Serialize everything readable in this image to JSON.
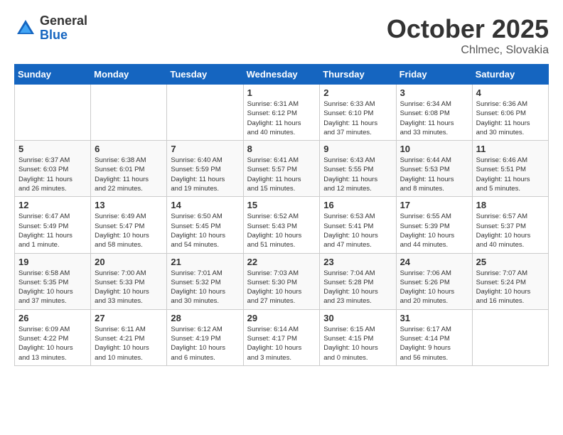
{
  "header": {
    "logo_general": "General",
    "logo_blue": "Blue",
    "month_title": "October 2025",
    "location": "Chlmec, Slovakia"
  },
  "days_of_week": [
    "Sunday",
    "Monday",
    "Tuesday",
    "Wednesday",
    "Thursday",
    "Friday",
    "Saturday"
  ],
  "weeks": [
    [
      {
        "day": "",
        "info": ""
      },
      {
        "day": "",
        "info": ""
      },
      {
        "day": "",
        "info": ""
      },
      {
        "day": "1",
        "info": "Sunrise: 6:31 AM\nSunset: 6:12 PM\nDaylight: 11 hours\nand 40 minutes."
      },
      {
        "day": "2",
        "info": "Sunrise: 6:33 AM\nSunset: 6:10 PM\nDaylight: 11 hours\nand 37 minutes."
      },
      {
        "day": "3",
        "info": "Sunrise: 6:34 AM\nSunset: 6:08 PM\nDaylight: 11 hours\nand 33 minutes."
      },
      {
        "day": "4",
        "info": "Sunrise: 6:36 AM\nSunset: 6:06 PM\nDaylight: 11 hours\nand 30 minutes."
      }
    ],
    [
      {
        "day": "5",
        "info": "Sunrise: 6:37 AM\nSunset: 6:03 PM\nDaylight: 11 hours\nand 26 minutes."
      },
      {
        "day": "6",
        "info": "Sunrise: 6:38 AM\nSunset: 6:01 PM\nDaylight: 11 hours\nand 22 minutes."
      },
      {
        "day": "7",
        "info": "Sunrise: 6:40 AM\nSunset: 5:59 PM\nDaylight: 11 hours\nand 19 minutes."
      },
      {
        "day": "8",
        "info": "Sunrise: 6:41 AM\nSunset: 5:57 PM\nDaylight: 11 hours\nand 15 minutes."
      },
      {
        "day": "9",
        "info": "Sunrise: 6:43 AM\nSunset: 5:55 PM\nDaylight: 11 hours\nand 12 minutes."
      },
      {
        "day": "10",
        "info": "Sunrise: 6:44 AM\nSunset: 5:53 PM\nDaylight: 11 hours\nand 8 minutes."
      },
      {
        "day": "11",
        "info": "Sunrise: 6:46 AM\nSunset: 5:51 PM\nDaylight: 11 hours\nand 5 minutes."
      }
    ],
    [
      {
        "day": "12",
        "info": "Sunrise: 6:47 AM\nSunset: 5:49 PM\nDaylight: 11 hours\nand 1 minute."
      },
      {
        "day": "13",
        "info": "Sunrise: 6:49 AM\nSunset: 5:47 PM\nDaylight: 10 hours\nand 58 minutes."
      },
      {
        "day": "14",
        "info": "Sunrise: 6:50 AM\nSunset: 5:45 PM\nDaylight: 10 hours\nand 54 minutes."
      },
      {
        "day": "15",
        "info": "Sunrise: 6:52 AM\nSunset: 5:43 PM\nDaylight: 10 hours\nand 51 minutes."
      },
      {
        "day": "16",
        "info": "Sunrise: 6:53 AM\nSunset: 5:41 PM\nDaylight: 10 hours\nand 47 minutes."
      },
      {
        "day": "17",
        "info": "Sunrise: 6:55 AM\nSunset: 5:39 PM\nDaylight: 10 hours\nand 44 minutes."
      },
      {
        "day": "18",
        "info": "Sunrise: 6:57 AM\nSunset: 5:37 PM\nDaylight: 10 hours\nand 40 minutes."
      }
    ],
    [
      {
        "day": "19",
        "info": "Sunrise: 6:58 AM\nSunset: 5:35 PM\nDaylight: 10 hours\nand 37 minutes."
      },
      {
        "day": "20",
        "info": "Sunrise: 7:00 AM\nSunset: 5:33 PM\nDaylight: 10 hours\nand 33 minutes."
      },
      {
        "day": "21",
        "info": "Sunrise: 7:01 AM\nSunset: 5:32 PM\nDaylight: 10 hours\nand 30 minutes."
      },
      {
        "day": "22",
        "info": "Sunrise: 7:03 AM\nSunset: 5:30 PM\nDaylight: 10 hours\nand 27 minutes."
      },
      {
        "day": "23",
        "info": "Sunrise: 7:04 AM\nSunset: 5:28 PM\nDaylight: 10 hours\nand 23 minutes."
      },
      {
        "day": "24",
        "info": "Sunrise: 7:06 AM\nSunset: 5:26 PM\nDaylight: 10 hours\nand 20 minutes."
      },
      {
        "day": "25",
        "info": "Sunrise: 7:07 AM\nSunset: 5:24 PM\nDaylight: 10 hours\nand 16 minutes."
      }
    ],
    [
      {
        "day": "26",
        "info": "Sunrise: 6:09 AM\nSunset: 4:22 PM\nDaylight: 10 hours\nand 13 minutes."
      },
      {
        "day": "27",
        "info": "Sunrise: 6:11 AM\nSunset: 4:21 PM\nDaylight: 10 hours\nand 10 minutes."
      },
      {
        "day": "28",
        "info": "Sunrise: 6:12 AM\nSunset: 4:19 PM\nDaylight: 10 hours\nand 6 minutes."
      },
      {
        "day": "29",
        "info": "Sunrise: 6:14 AM\nSunset: 4:17 PM\nDaylight: 10 hours\nand 3 minutes."
      },
      {
        "day": "30",
        "info": "Sunrise: 6:15 AM\nSunset: 4:15 PM\nDaylight: 10 hours\nand 0 minutes."
      },
      {
        "day": "31",
        "info": "Sunrise: 6:17 AM\nSunset: 4:14 PM\nDaylight: 9 hours\nand 56 minutes."
      },
      {
        "day": "",
        "info": ""
      }
    ]
  ]
}
